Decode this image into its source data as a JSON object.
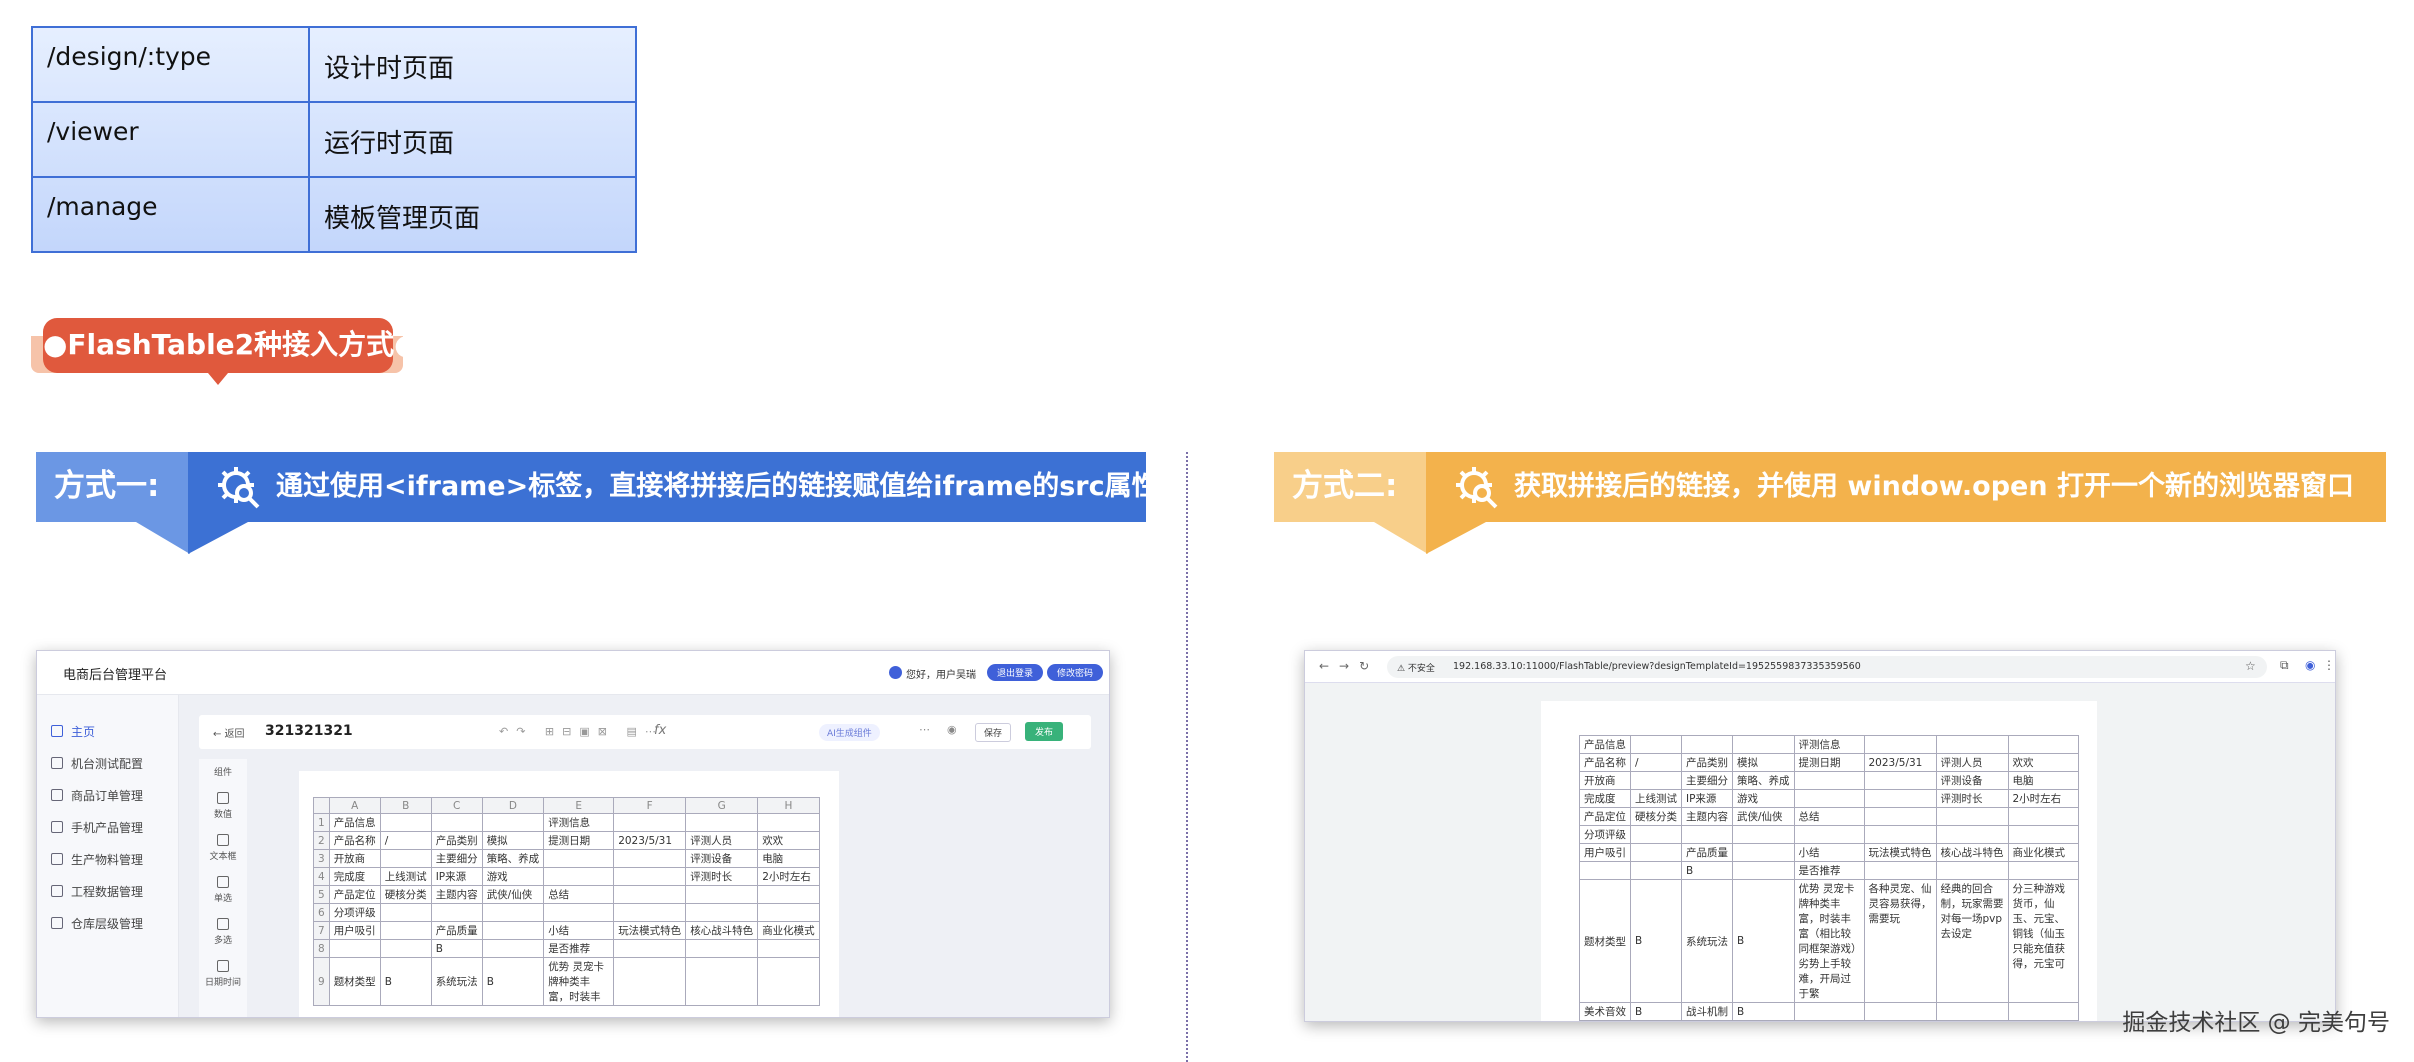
{
  "routes": [
    {
      "path": "/design/:type",
      "desc": "设计时页面"
    },
    {
      "path": "/viewer",
      "desc": "运行时页面"
    },
    {
      "path": "/manage",
      "desc": "模板管理页面"
    }
  ],
  "badge": {
    "title": "●FlashTable2种接入方式●",
    "color": "#e0593d"
  },
  "method1": {
    "label": "方式一:",
    "text": "通过使用<iframe>标签，直接将拼接后的链接赋值给iframe的src属性",
    "color": "#3c71d4",
    "light": "#6b97e4"
  },
  "method2": {
    "label": "方式二:",
    "text": "获取拼接后的链接，并使用 window.open 打开一个新的浏览器窗口",
    "color": "#f3b24c",
    "light": "#f8cf8a"
  },
  "shot1": {
    "app_title": "电商后台管理平台",
    "greeting": "您好，用户吴瑞",
    "logout": "退出登录",
    "change_pwd": "修改密码",
    "back": "← 返回",
    "doc_title": "321321321",
    "ai_btn": "AI生成组件",
    "save": "保存",
    "publish": "发布",
    "sidebar": [
      "主页",
      "机台测试配置",
      "商品订单管理",
      "手机产品管理",
      "生产物料管理",
      "工程数据管理",
      "仓库层级管理"
    ],
    "tools_header": "组件",
    "tools": [
      "数值",
      "文本框",
      "单选",
      "多选",
      "日期时间"
    ],
    "columns": [
      "",
      "A",
      "B",
      "C",
      "D",
      "E",
      "F",
      "G",
      "H"
    ],
    "rows": [
      [
        "1",
        "产品信息",
        "",
        "",
        "",
        "评测信息",
        "",
        "",
        ""
      ],
      [
        "2",
        "产品名称",
        "/",
        "产品类别",
        "模拟",
        "提测日期",
        "2023/5/31",
        "评测人员",
        "欢欢"
      ],
      [
        "3",
        "开放商",
        "",
        "主要细分",
        "策略、养成",
        "",
        "",
        "评测设备",
        "电脑"
      ],
      [
        "4",
        "完成度",
        "上线测试",
        "IP来源",
        "游戏",
        "",
        "",
        "评测时长",
        "2小时左右"
      ],
      [
        "5",
        "产品定位",
        "硬核分类",
        "主题内容",
        "武侠/仙侠",
        "总结",
        "",
        "",
        ""
      ],
      [
        "6",
        "分项评级",
        "",
        "",
        "",
        "",
        "",
        "",
        ""
      ],
      [
        "7",
        "用户吸引",
        "",
        "产品质量",
        "",
        "小结",
        "玩法模式特色",
        "核心战斗特色",
        "商业化模式"
      ],
      [
        "8",
        "",
        "",
        "B",
        "",
        "是否推荐",
        "",
        "",
        ""
      ],
      [
        "9",
        "题材类型",
        "B",
        "系统玩法",
        "B",
        "优势 灵宠卡牌种类丰富，时装丰",
        "",
        "",
        ""
      ]
    ]
  },
  "shot2": {
    "security": "⚠ 不安全",
    "url": "192.168.33.10:11000/FlashTable/preview?designTemplateId=1952559837335359560",
    "rows": [
      [
        "产品信息",
        "",
        "",
        "",
        "评测信息",
        "",
        "",
        ""
      ],
      [
        "产品名称",
        "/",
        "产品类别",
        "模拟",
        "提测日期",
        "2023/5/31",
        "评测人员",
        "欢欢"
      ],
      [
        "开放商",
        "",
        "主要细分",
        "策略、养成",
        "",
        "",
        "评测设备",
        "电脑"
      ],
      [
        "完成度",
        "上线测试",
        "IP来源",
        "游戏",
        "",
        "",
        "评测时长",
        "2小时左右"
      ],
      [
        "产品定位",
        "硬核分类",
        "主题内容",
        "武侠/仙侠",
        "总结",
        "",
        "",
        ""
      ],
      [
        "分项评级",
        "",
        "",
        "",
        "",
        "",
        "",
        ""
      ],
      [
        "用户吸引",
        "",
        "产品质量",
        "",
        "小结",
        "玩法模式特色",
        "核心战斗特色",
        "商业化模式"
      ],
      [
        "",
        "",
        "B",
        "",
        "是否推荐",
        "",
        "",
        ""
      ],
      [
        "题材类型",
        "B",
        "系统玩法",
        "B",
        "优势 灵宠卡牌种类丰富，时装丰富（相比较同框架游戏）劣势上手较难，开局过于繁",
        "各种灵宠、仙灵容易获得，需要玩",
        "经典的回合制，玩家需要对每一场pvp去设定",
        "分三种游戏货币，仙玉、元宝、铜钱（仙玉只能充值获得，元宝可"
      ],
      [
        "美术音效",
        "B",
        "战斗机制",
        "B",
        "",
        "",
        "",
        ""
      ]
    ]
  },
  "watermark": "掘金技术社区 @ 完美句号"
}
